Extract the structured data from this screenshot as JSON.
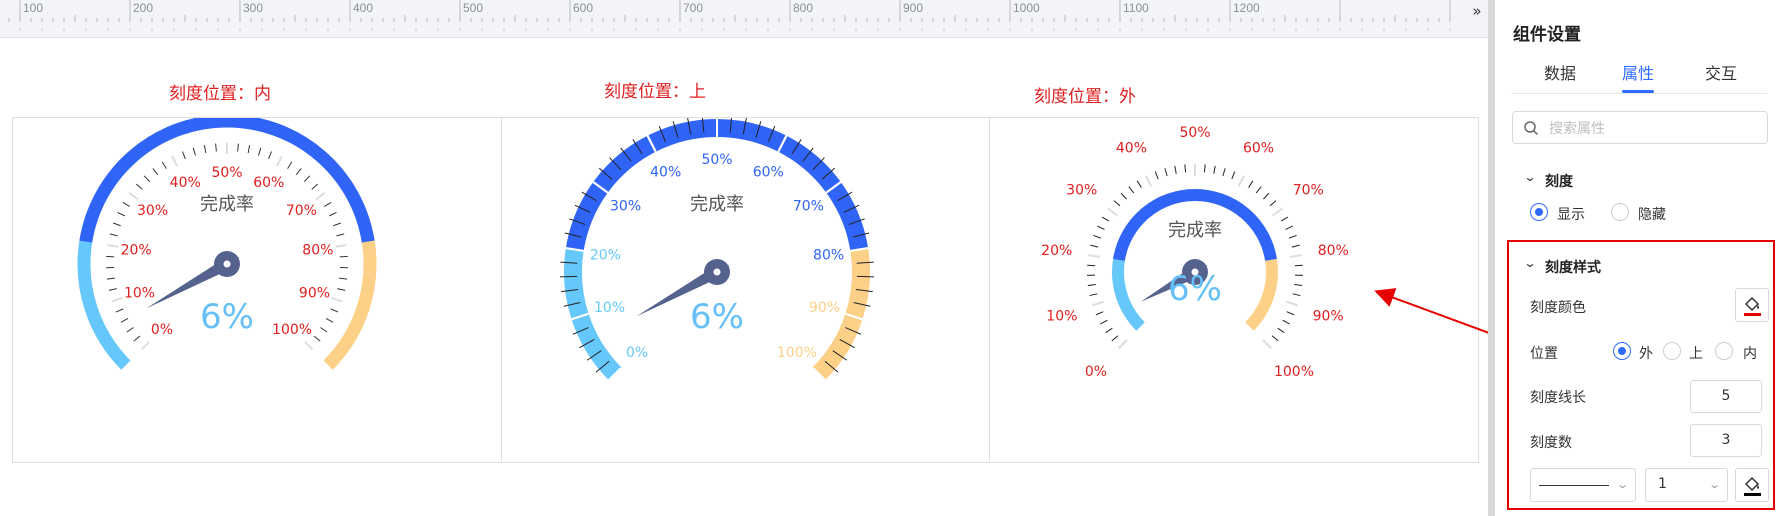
{
  "ruler": {
    "labels": [
      "100",
      "200",
      "300",
      "400",
      "500",
      "600",
      "700",
      "800",
      "900",
      "1000",
      "1100",
      "1200"
    ],
    "expand_icon": "double-chevron-right-icon"
  },
  "gauges": [
    {
      "title": "刻度位置：内",
      "center_label": "完成率",
      "value_text": "6%",
      "value": 6,
      "tick_position": "inside",
      "tick_labels": [
        "0%",
        "10%",
        "20%",
        "30%",
        "40%",
        "50%",
        "60%",
        "70%",
        "80%",
        "90%",
        "100%"
      ]
    },
    {
      "title": "刻度位置：上",
      "center_label": "完成率",
      "value_text": "6%",
      "value": 6,
      "tick_position": "on",
      "tick_labels": [
        "0%",
        "10%",
        "20%",
        "30%",
        "40%",
        "50%",
        "60%",
        "70%",
        "80%",
        "90%",
        "100%"
      ]
    },
    {
      "title": "刻度位置：外",
      "center_label": "完成率",
      "value_text": "6%",
      "value": 6,
      "tick_position": "outside",
      "tick_labels": [
        "0%",
        "10%",
        "20%",
        "30%",
        "40%",
        "50%",
        "60%",
        "70%",
        "80%",
        "90%",
        "100%"
      ]
    }
  ],
  "colors": {
    "segment_low": "#66c8fa",
    "segment_mid": "#2f64f6",
    "segment_high": "#fdd087",
    "pointer": "#55628d",
    "value_text": "#66c0f7",
    "label_red": "#e02020",
    "accent": "#2f6bff",
    "highlight_red": "#e60000"
  },
  "panel": {
    "title": "组件设置",
    "tabs": [
      {
        "label": "数据"
      },
      {
        "label": "属性"
      },
      {
        "label": "交互"
      }
    ],
    "search": {
      "placeholder": "搜索属性"
    },
    "ticks_section": {
      "title": "刻度",
      "options": [
        {
          "label": "显示",
          "selected": true
        },
        {
          "label": "隐藏",
          "selected": false
        }
      ]
    },
    "style_section": {
      "title": "刻度样式",
      "color_label": "刻度颜色",
      "color_value": "#e60000",
      "position_label": "位置",
      "position_options": [
        {
          "label": "外",
          "selected": true
        },
        {
          "label": "上",
          "selected": false
        },
        {
          "label": "内",
          "selected": false
        }
      ],
      "length_label": "刻度线长",
      "length_value": "5",
      "count_label": "刻度数",
      "count_value": "3",
      "line_width_value": "1"
    }
  }
}
